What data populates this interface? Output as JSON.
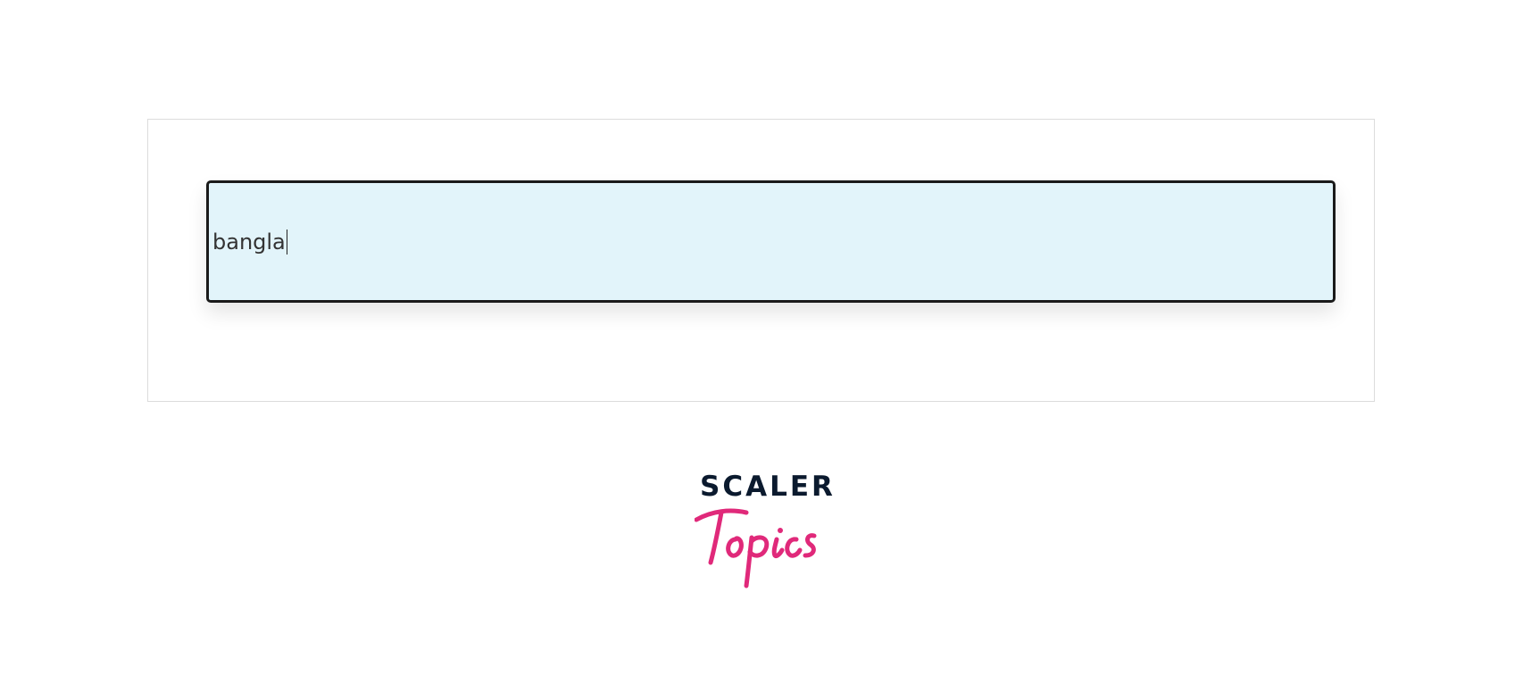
{
  "search": {
    "value": "bangla"
  },
  "logo": {
    "line1": "SCALER",
    "line2": "Topics",
    "colors": {
      "line1": "#0b1a2e",
      "line2": "#e0297a"
    }
  },
  "colors": {
    "input_background": "#e2f4fa",
    "input_border": "#1a1a1a",
    "frame_border": "#dcdcdc"
  }
}
